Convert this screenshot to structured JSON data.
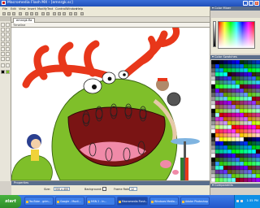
{
  "window": {
    "title": "Macromedia Flash MX - [emnrgk.sc]",
    "controls": {
      "minimize": "_",
      "maximize": "□",
      "close": "×"
    }
  },
  "menu": {
    "items": [
      "File",
      "Edit",
      "View",
      "Insert",
      "Modify",
      "Text",
      "Control",
      "Window",
      "Help"
    ]
  },
  "document": {
    "tab_label": "emnrgk.fla",
    "timeline_header": "Timeline"
  },
  "properties": {
    "header": "Properties",
    "field1_label": "Size:",
    "field1_value": "550 x 400",
    "background_label": "Background:",
    "framerate_label": "Frame Rate:",
    "framerate_value": "12"
  },
  "panels": {
    "color_mixer": "Color Mixer",
    "color_swatches": "Color Swatches",
    "components": "Components"
  },
  "taskbar": {
    "start_label": "start",
    "tasks": [
      {
        "label": "YouTube - grim...",
        "active": false
      },
      {
        "label": "Google - Mozil...",
        "active": false
      },
      {
        "label": "MSN 2 - In...",
        "active": false
      },
      {
        "label": "Macromedia Flash...",
        "active": true
      },
      {
        "label": "Windows Media...",
        "active": false
      },
      {
        "label": "Adobe Photoshop",
        "active": false
      }
    ],
    "clock": "1:35 PM"
  },
  "colors": {
    "monster_green": "#7fbf2a",
    "antler_red": "#e8371a",
    "mouth_dark": "#7a1414",
    "tongue_pink": "#f08aa8",
    "title_blue": "#2357c9",
    "start_green": "#3fa23a"
  },
  "icons": {
    "app": "flash-app-icon",
    "close": "close-icon",
    "minimize": "minimize-icon",
    "maximize": "maximize-icon",
    "panel_collapse": "triangle-down-icon"
  }
}
